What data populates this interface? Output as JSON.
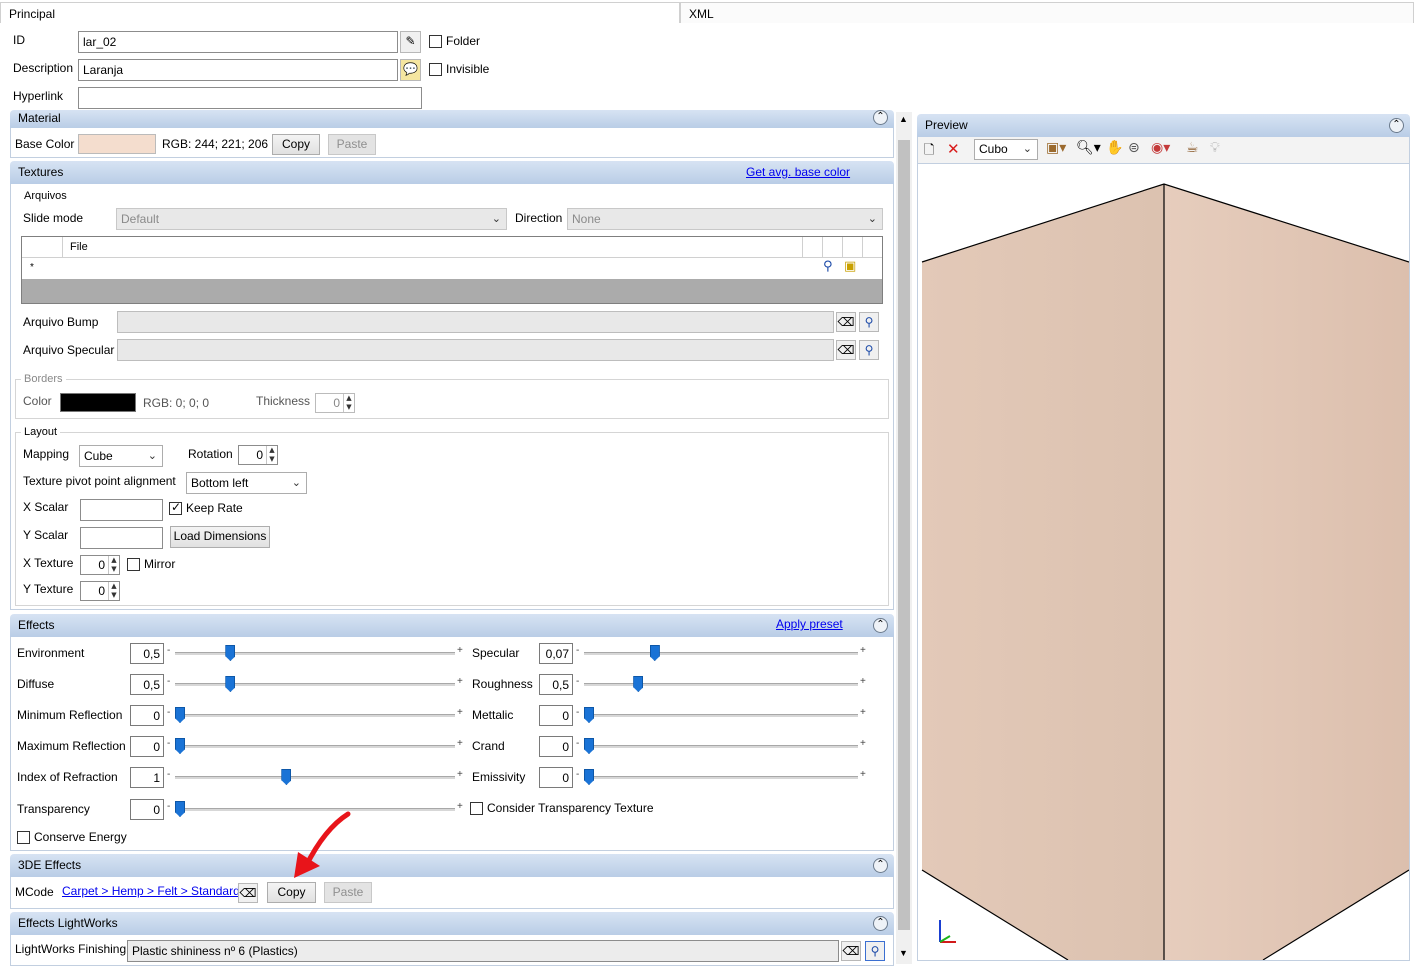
{
  "tabs": {
    "principal": "Principal",
    "xml": "XML"
  },
  "header": {
    "id_label": "ID",
    "id_value": "lar_02",
    "description_label": "Description",
    "description_value": "Laranja",
    "hyperlink_label": "Hyperlink",
    "hyperlink_value": "",
    "folder_label": "Folder",
    "invisible_label": "Invisible"
  },
  "material": {
    "title": "Material",
    "base_color_label": "Base Color",
    "base_color": "#f4ddce",
    "rgb_text": "RGB: 244; 221; 206",
    "copy": "Copy",
    "paste": "Paste"
  },
  "textures": {
    "title": "Textures",
    "avg_link": "Get avg. base color",
    "arquivos": "Arquivos",
    "slide_mode_label": "Slide mode",
    "slide_mode_value": "Default",
    "direction_label": "Direction",
    "direction_value": "None",
    "file_col": "File",
    "new_row_marker": "*",
    "bump_label": "Arquivo Bump",
    "specular_label": "Arquivo Specular",
    "borders_title": "Borders",
    "color_label": "Color",
    "border_color": "#000000",
    "border_rgb": "RGB: 0; 0; 0",
    "thickness_label": "Thickness",
    "thickness_value": "0",
    "layout_title": "Layout",
    "mapping_label": "Mapping",
    "mapping_value": "Cube",
    "rotation_label": "Rotation",
    "rotation_value": "0",
    "pivot_label": "Texture pivot point alignment",
    "pivot_value": "Bottom left",
    "x_scalar_label": "X Scalar",
    "y_scalar_label": "Y Scalar",
    "keep_rate_label": "Keep Rate",
    "load_dimensions": "Load Dimensions",
    "x_texture_label": "X Texture",
    "x_texture_value": "0",
    "mirror_label": "Mirror",
    "y_texture_label": "Y Texture",
    "y_texture_value": "0"
  },
  "effects": {
    "title": "Effects",
    "apply_preset": "Apply preset",
    "left": [
      {
        "label": "Environment",
        "value": "0,5",
        "pos": 0.18
      },
      {
        "label": "Diffuse",
        "value": "0,5",
        "pos": 0.18
      },
      {
        "label": "Minimum Reflection",
        "value": "0",
        "pos": 0.0
      },
      {
        "label": "Maximum Reflection",
        "value": "0",
        "pos": 0.0
      },
      {
        "label": "Index of Refraction",
        "value": "1",
        "pos": 0.38
      },
      {
        "label": "Transparency",
        "value": "0",
        "pos": 0.0
      }
    ],
    "right": [
      {
        "label": "Specular",
        "value": "0,07",
        "pos": 0.24
      },
      {
        "label": "Roughness",
        "value": "0,5",
        "pos": 0.18
      },
      {
        "label": "Mettalic",
        "value": "0",
        "pos": 0.0
      },
      {
        "label": "Crand",
        "value": "0",
        "pos": 0.0
      },
      {
        "label": "Emissivity",
        "value": "0",
        "pos": 0.0
      }
    ],
    "consider_transparency": "Consider Transparency Texture",
    "conserve_energy": "Conserve Energy",
    "minus": "-",
    "plus": "+"
  },
  "effects3de": {
    "title": "3DE Effects",
    "mcode_label": "MCode",
    "mcode_link": "Carpet > Hemp > Felt > Standard",
    "copy": "Copy",
    "paste": "Paste"
  },
  "lightworks": {
    "title": "Effects LightWorks",
    "finishing_label": "LightWorks Finishing",
    "finishing_value": "Plastic shininess nº 6 (Plastics)"
  },
  "preview": {
    "title": "Preview",
    "shape_value": "Cubo",
    "face_left": "#e3c9b8",
    "face_right": "#dcbfad"
  }
}
